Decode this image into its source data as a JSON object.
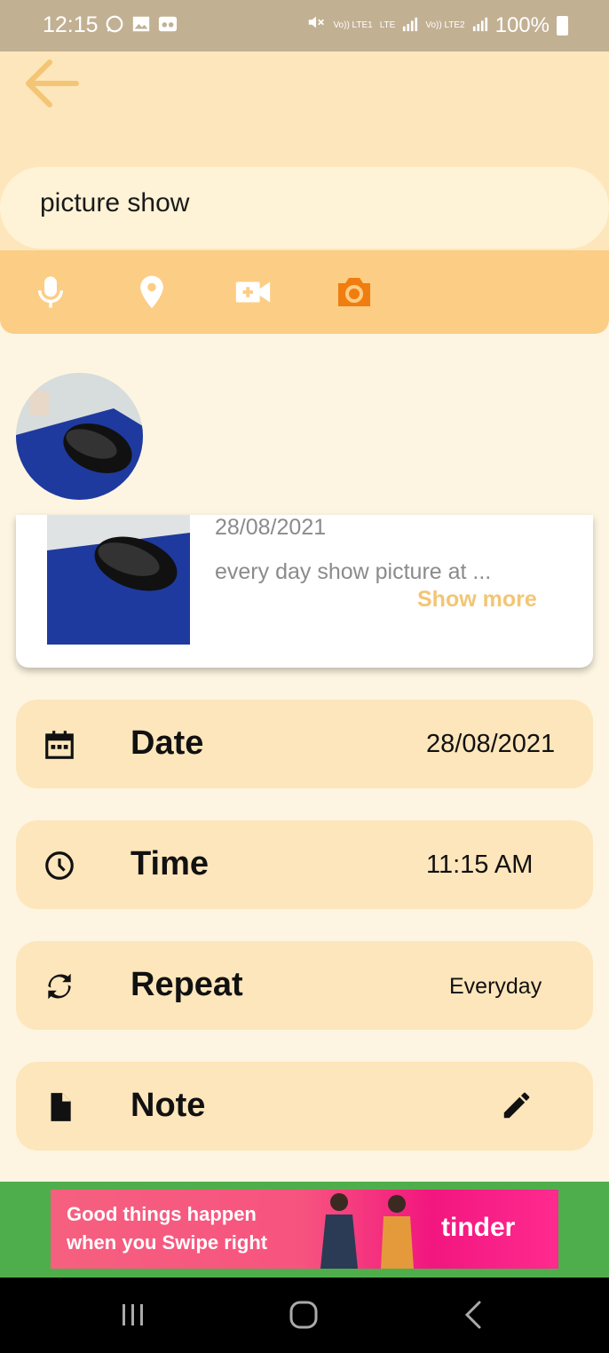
{
  "status_bar": {
    "time": "12:15",
    "battery": "100%",
    "sim1": "Vo)) LTE1",
    "sim2": "Vo)) LTE2",
    "network": "LTE"
  },
  "header": {
    "back_icon": "arrow-left-icon",
    "title_value": "picture show"
  },
  "toolbar": {
    "items": [
      {
        "icon": "microphone-icon"
      },
      {
        "icon": "location-pin-icon"
      },
      {
        "icon": "video-add-icon"
      },
      {
        "icon": "camera-icon",
        "active": true
      }
    ],
    "active_color": "#f07d0f",
    "inactive_color": "#ffffff"
  },
  "card": {
    "date": "28/08/2021",
    "description": "every day show picture at ...",
    "show_more": "Show more"
  },
  "rows": [
    {
      "icon": "calendar-icon",
      "label": "Date",
      "value": "28/08/2021"
    },
    {
      "icon": "clock-icon",
      "label": "Time",
      "value": "11:15 AM"
    },
    {
      "icon": "repeat-icon",
      "label": "Repeat",
      "value": "Everyday"
    },
    {
      "icon": "note-icon",
      "label": "Note",
      "action_icon": "pencil-icon"
    }
  ],
  "ad": {
    "line1": "Good things happen",
    "line2": "when you Swipe right",
    "brand": "tinder"
  },
  "colors": {
    "accent": "#f3c574",
    "header_bg": "#fde6bb",
    "toolbar_bg": "#fccd84",
    "page_bg": "#fdf5e2"
  }
}
